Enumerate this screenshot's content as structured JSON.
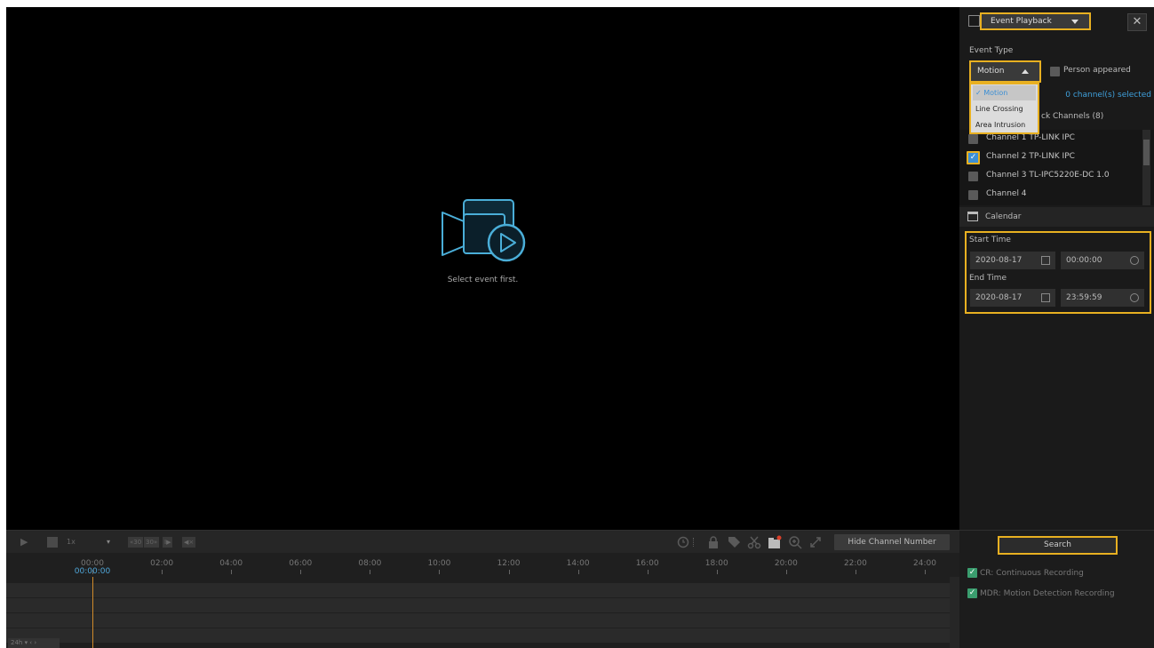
{
  "video": {
    "message": "Select event first."
  },
  "toolbar": {
    "speed": "1x",
    "skip_back": "30",
    "skip_fwd": "30",
    "hide_channel_label": "Hide Channel Number"
  },
  "timeline": {
    "hours": [
      "00:00",
      "02:00",
      "04:00",
      "06:00",
      "08:00",
      "10:00",
      "12:00",
      "14:00",
      "16:00",
      "18:00",
      "20:00",
      "22:00",
      "24:00"
    ],
    "current_time": "00:00:00",
    "zoom": "24h"
  },
  "panel": {
    "mode": "Event Playback",
    "close": "✕",
    "event_type_label": "Event Type",
    "event_type_value": "Motion",
    "person_appeared": "Person appeared",
    "dropdown_options": [
      "Motion",
      "Line Crossing",
      "Area Intrusion"
    ],
    "channels_selected": "0 channel(s) selected",
    "playback_channels": "ck Channels (8)",
    "channels": [
      {
        "label": "Channel 1 TP-LINK IPC",
        "checked": false
      },
      {
        "label": "Channel 2 TP-LINK IPC",
        "checked": true
      },
      {
        "label": "Channel 3 TL-IPC5220E-DC 1.0",
        "checked": false
      },
      {
        "label": "Channel 4",
        "checked": false
      }
    ],
    "calendar": "Calendar",
    "start_time_label": "Start Time",
    "start_date": "2020-08-17",
    "start_time": "00:00:00",
    "end_time_label": "End Time",
    "end_date": "2020-08-17",
    "end_time": "23:59:59",
    "search": "Search",
    "legend": [
      {
        "label": "CR: Continuous Recording"
      },
      {
        "label": "MDR: Motion Detection Recording"
      }
    ]
  },
  "colors": {
    "accent": "#3fa0dc",
    "highlight": "#e8b021",
    "cursor": "#d08a2a"
  }
}
